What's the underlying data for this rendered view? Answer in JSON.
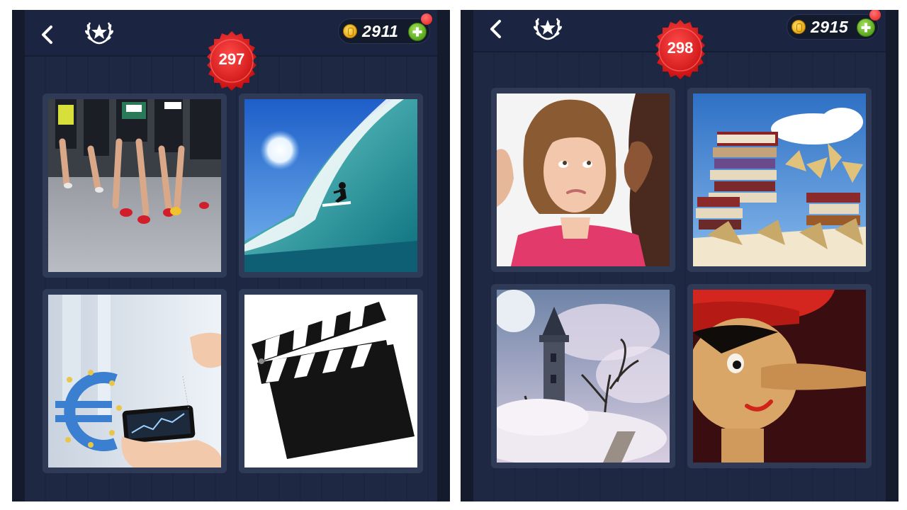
{
  "screens": [
    {
      "level": "297",
      "coins": "2911",
      "tiles": [
        {
          "icon": "marathon-runners-photo"
        },
        {
          "icon": "surfer-wave-photo"
        },
        {
          "icon": "euro-stock-phone-photo"
        },
        {
          "icon": "film-clapperboard-photo"
        }
      ]
    },
    {
      "level": "298",
      "coins": "2915",
      "tiles": [
        {
          "icon": "whispering-women-photo"
        },
        {
          "icon": "stacked-books-photo"
        },
        {
          "icon": "castle-tower-clouds-photo"
        },
        {
          "icon": "pinocchio-nose-photo"
        }
      ]
    }
  ],
  "colors": {
    "screen_bg": "#141b2d",
    "panel": "#1e2842",
    "badge_red": "#e01b1b",
    "coin_gold": "#f2c12e",
    "plus_green": "#5aa71f"
  }
}
